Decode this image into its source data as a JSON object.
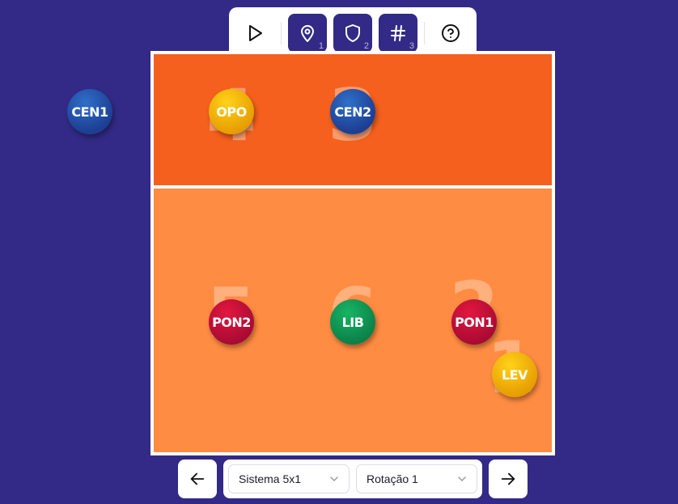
{
  "colors": {
    "background": "#322a86",
    "court_front": "#f5601e",
    "court_back": "#ff8c42",
    "court_lines": "#ffffff",
    "button_accent": "#322a86"
  },
  "toolbar": {
    "buttons": [
      {
        "name": "play",
        "icon": "play-icon",
        "badge": ""
      },
      {
        "name": "positions",
        "icon": "map-pin-icon",
        "badge": "1"
      },
      {
        "name": "defense",
        "icon": "shield-icon",
        "badge": "2"
      },
      {
        "name": "numbers",
        "icon": "hash-icon",
        "badge": "3"
      },
      {
        "name": "help",
        "icon": "help-circle-icon",
        "badge": ""
      }
    ]
  },
  "court": {
    "zones": [
      "4",
      "3",
      "5",
      "6",
      "2",
      "1"
    ],
    "players": [
      {
        "label": "CEN1",
        "color": "blue"
      },
      {
        "label": "OPO",
        "color": "yellow"
      },
      {
        "label": "CEN2",
        "color": "blue"
      },
      {
        "label": "PON2",
        "color": "red"
      },
      {
        "label": "LIB",
        "color": "green"
      },
      {
        "label": "PON1",
        "color": "red"
      },
      {
        "label": "LEV",
        "color": "yellow"
      }
    ]
  },
  "controls": {
    "system_select": "Sistema 5x1",
    "rotation_select": "Rotação 1",
    "prev_icon": "arrow-left-icon",
    "next_icon": "arrow-right-icon"
  }
}
